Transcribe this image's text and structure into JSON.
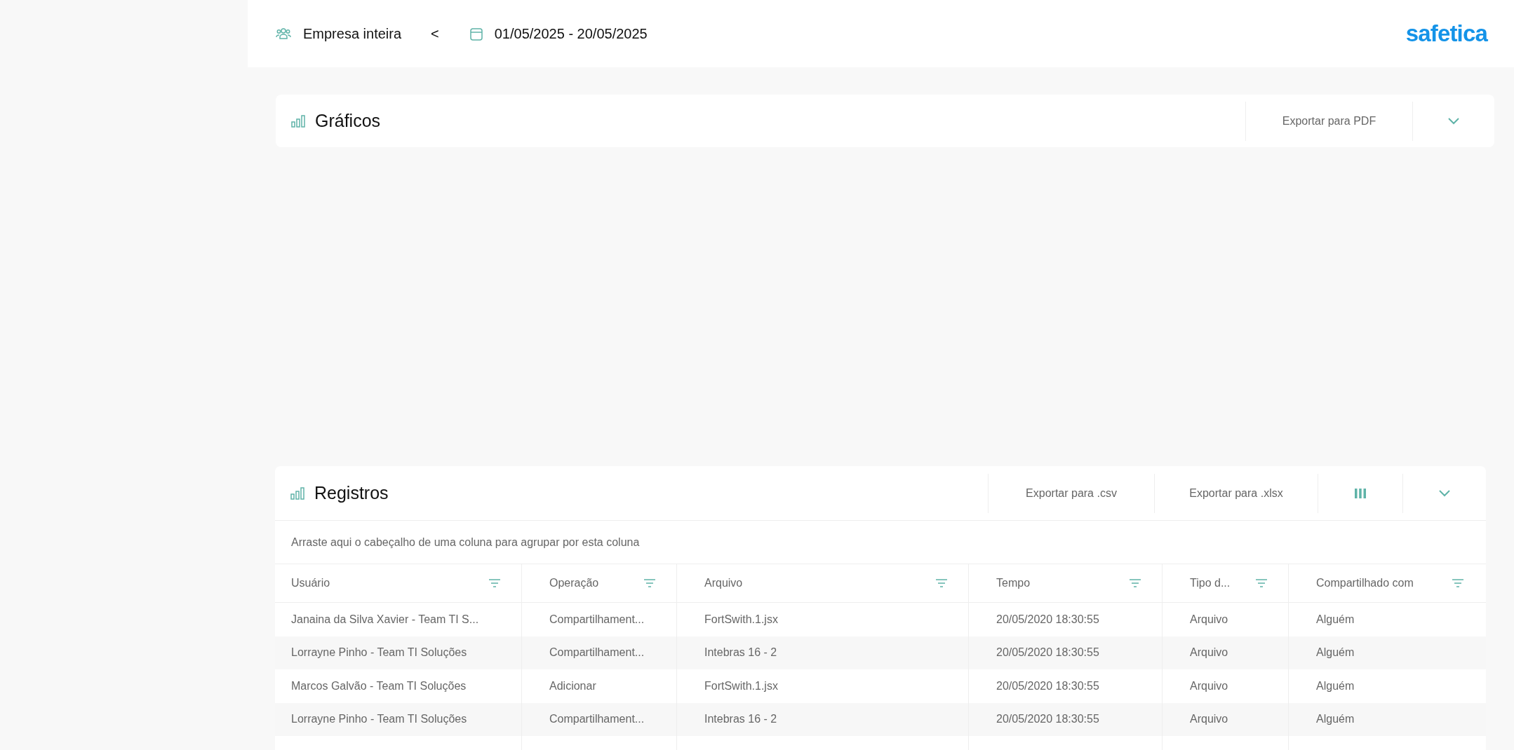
{
  "top_bar": {
    "scope": "Empresa inteira",
    "back_symbol": "<",
    "date_range": "01/05/2025 - 20/05/2025",
    "logo": "safetica"
  },
  "charts_panel": {
    "title": "Gráficos",
    "export_button": "Exportar para PDF",
    "expanded": false
  },
  "records_panel": {
    "title": "Registros",
    "export_buttons": [
      "Exportar para .csv",
      "Exportar para .xlsx"
    ],
    "expanded": false,
    "group_hint": "Arraste aqui o cabeçalho de uma coluna para agrupar por esta coluna",
    "table": {
      "columns": [
        "Usuário",
        "Operação",
        "Arquivo",
        "Tempo",
        "Tipo d...",
        "Compartilhado com"
      ],
      "rows": [
        [
          "Janaina da Silva Xavier - Team TI S...",
          "Compartilhament...",
          "FortSwith.1.jsx",
          "20/05/2020 18:30:55",
          "Arquivo",
          "Alguém"
        ],
        [
          "Lorrayne Pinho - Team TI Soluções",
          "Compartilhament...",
          "Intebras 16 - 2",
          "20/05/2020 18:30:55",
          "Arquivo",
          "Alguém"
        ],
        [
          "Marcos Galvão - Team TI Soluções",
          "Adicionar",
          "FortSwith.1.jsx",
          "20/05/2020 18:30:55",
          "Arquivo",
          "Alguém"
        ],
        [
          "Lorrayne Pinho - Team TI Soluções",
          "Compartilhament...",
          "Intebras 16 - 2",
          "20/05/2020 18:30:55",
          "Arquivo",
          "Alguém"
        ]
      ]
    }
  }
}
